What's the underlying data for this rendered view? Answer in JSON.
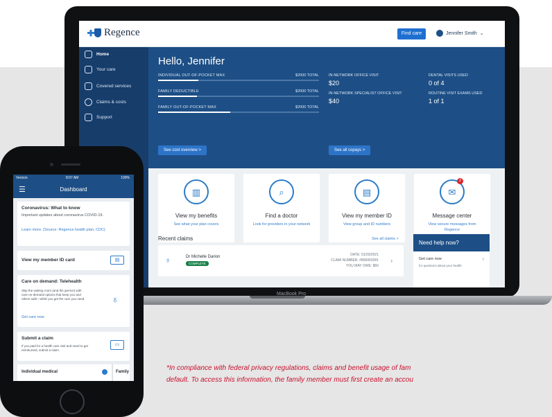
{
  "desktop": {
    "brand": "Regence",
    "find_care": "Find care",
    "user_name": "Jennifer Smith",
    "nav": [
      "Home",
      "Your care",
      "Covered services",
      "Claims & costs",
      "Support"
    ],
    "greeting": "Hello, Jennifer",
    "metrics": [
      {
        "label": "INDIVIDUAL OUT-OF-POCKET MAX",
        "total": "$2000 TOTAL",
        "progress": 0.25
      },
      {
        "label": "FAMILY DEDUCTIBLE",
        "total": "$2000 TOTAL",
        "progress": 0.24
      },
      {
        "label": "FAMILY OUT-OF-POCKET MAX",
        "total": "$2000 TOTAL",
        "progress": 0.45
      }
    ],
    "copays": [
      {
        "label": "IN-NETWORK OFFICE VISIT",
        "value": "$20"
      },
      {
        "label": "IN-NETWORK SPECIALIST OFFICE VISIT",
        "value": "$40"
      }
    ],
    "usage": [
      {
        "label": "DENTAL VISITS USED",
        "value": "0 of 4"
      },
      {
        "label": "ROUTINE VISIT EXAMS USED",
        "value": "1 of 1"
      }
    ],
    "see_cost_overview": "See cost overview  >",
    "see_all_copays": "See all copays  >",
    "cards": [
      {
        "title": "View my benefits",
        "sub": "See what your plan covers",
        "icon": "bar-chart-icon"
      },
      {
        "title": "Find a doctor",
        "sub": "Look for providers in your network",
        "icon": "search-doctor-icon"
      },
      {
        "title": "View my member ID",
        "sub": "View group and ID numbers",
        "icon": "id-card-icon"
      },
      {
        "title": "Message center",
        "sub": "View secure messages from Regence",
        "icon": "envelope-icon",
        "badge": "2"
      }
    ],
    "recent_claims": "Recent claims",
    "see_all_claims": "See all claims  >",
    "claim": {
      "provider": "Dr Michelle Darion",
      "status": "COMPLETE",
      "date": "DATE: 01/20/2021",
      "number": "CLAIM NUMBER: #806959281",
      "owe": "YOU MAY OWE: $60"
    },
    "help": {
      "title": "Need help now?",
      "row": "Get care now",
      "sub": "for questions about your health"
    },
    "macbook_label": "MacBook Pro"
  },
  "mobile": {
    "carrier": "Verizon",
    "time": "8:07 AM",
    "battery": "100%",
    "title": "Dashboard",
    "covid": {
      "title": "Coronavirus: What to know",
      "body": "Important updates about coronavirus COVID-19.",
      "link": "Learn more. (Source: Regence health plan, CDC)"
    },
    "member_id": "View my member ID card",
    "telehealth": {
      "title": "Care on demand: Telehealth",
      "body": "Skip the waiting room (and the germs!) with care-on-demand options that keep you and others safe—while you get the care you need.",
      "link": "Get care now"
    },
    "submit": {
      "title": "Submit a claim",
      "body": "If you paid for a health care visit and need to get reimbursed, submit a claim."
    },
    "tabs": [
      "Individual medical",
      "Family"
    ]
  },
  "disclaimer": [
    "*In compliance with federal privacy regulations, claims and benefit usage of fam",
    "default. To access this information, the family member must first create an accou"
  ],
  "colors": {
    "navy": "#173d6b",
    "hero_blue": "#1d4f86",
    "accent_blue": "#2a7bc8",
    "disclaimer_red": "#c8102e"
  }
}
